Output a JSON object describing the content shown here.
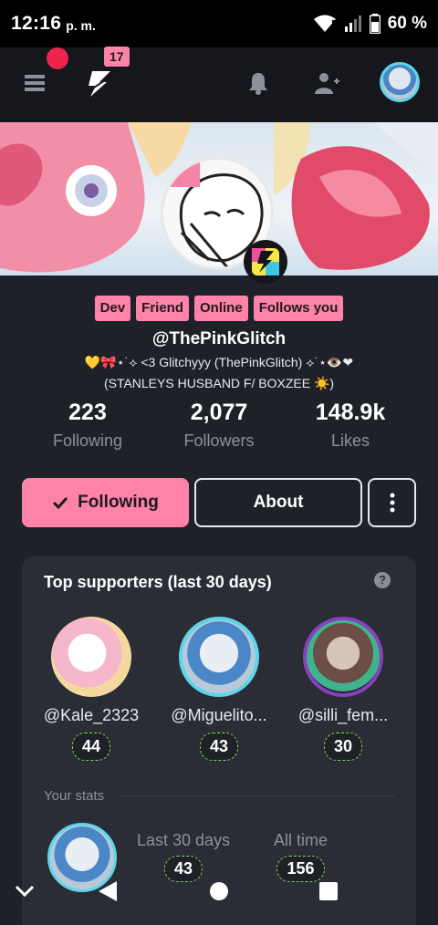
{
  "status_bar": {
    "time": "12:16",
    "ampm": "p. m.",
    "battery": "60 %"
  },
  "topbar": {
    "notification_count": "17"
  },
  "profile": {
    "tags": [
      "Dev",
      "Friend",
      "Online",
      "Follows you"
    ],
    "handle": "@ThePinkGlitch",
    "bio_line1": "💛🎀⋆˙⟡ <3 Glitchyyy (ThePinkGlitch) ⟡˙⋆👁️❤",
    "bio_line2": "(STANLEYS HUSBAND F/ BOXZEE ☀️)",
    "stats": [
      {
        "value": "223",
        "label": "Following"
      },
      {
        "value": "2,077",
        "label": "Followers"
      },
      {
        "value": "148.9k",
        "label": "Likes"
      }
    ]
  },
  "actions": {
    "following_label": "Following",
    "about_label": "About"
  },
  "supporters": {
    "title": "Top supporters (last 30 days)",
    "help": "?",
    "items": [
      {
        "name": "@Kale_2323",
        "points": "44"
      },
      {
        "name": "@Miguelito...",
        "points": "43"
      },
      {
        "name": "@silli_fem...",
        "points": "30"
      }
    ],
    "your_stats_label": "Your stats",
    "last30_label": "Last 30 days",
    "last30_value": "43",
    "alltime_label": "All time",
    "alltime_value": "156"
  },
  "colors": {
    "accent": "#ff82a8",
    "background": "#1f2129",
    "card": "#2b2d36",
    "notif": "#f0234f"
  }
}
